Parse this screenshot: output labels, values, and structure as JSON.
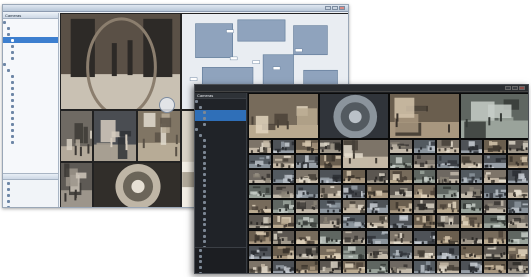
{
  "light_window": {
    "title": "",
    "sidebar_header": "Cameras",
    "tree": [
      {
        "label": "",
        "indent": 0,
        "selected": false
      },
      {
        "label": "",
        "indent": 1,
        "selected": false
      },
      {
        "label": "",
        "indent": 1,
        "selected": false
      },
      {
        "label": "",
        "indent": 2,
        "selected": true
      },
      {
        "label": "",
        "indent": 2,
        "selected": false
      },
      {
        "label": "",
        "indent": 2,
        "selected": false
      },
      {
        "label": "",
        "indent": 2,
        "selected": false
      },
      {
        "label": "",
        "indent": 0,
        "selected": false
      },
      {
        "label": "",
        "indent": 1,
        "selected": false
      },
      {
        "label": "",
        "indent": 2,
        "selected": false
      },
      {
        "label": "",
        "indent": 2,
        "selected": false
      },
      {
        "label": "",
        "indent": 2,
        "selected": false
      },
      {
        "label": "",
        "indent": 2,
        "selected": false
      },
      {
        "label": "",
        "indent": 2,
        "selected": false
      },
      {
        "label": "",
        "indent": 2,
        "selected": false
      },
      {
        "label": "",
        "indent": 2,
        "selected": false
      },
      {
        "label": "",
        "indent": 2,
        "selected": false
      },
      {
        "label": "",
        "indent": 2,
        "selected": false
      },
      {
        "label": "",
        "indent": 2,
        "selected": false
      },
      {
        "label": "",
        "indent": 2,
        "selected": false
      },
      {
        "label": "",
        "indent": 2,
        "selected": false
      }
    ],
    "sidebar_footer_header": "",
    "footer_items": [
      "",
      "",
      "",
      "",
      ""
    ]
  },
  "dark_window": {
    "title": "",
    "sidebar_header": "Cameras",
    "tree": [
      {
        "label": "",
        "indent": 0,
        "selected": false
      },
      {
        "label": "",
        "indent": 1,
        "selected": false
      },
      {
        "label": "",
        "indent": 2,
        "selected": true
      },
      {
        "label": "",
        "indent": 2,
        "selected": true
      },
      {
        "label": "",
        "indent": 2,
        "selected": false
      },
      {
        "label": "",
        "indent": 0,
        "selected": false
      },
      {
        "label": "",
        "indent": 1,
        "selected": false
      },
      {
        "label": "",
        "indent": 2,
        "selected": false
      },
      {
        "label": "",
        "indent": 2,
        "selected": false
      },
      {
        "label": "",
        "indent": 2,
        "selected": false
      },
      {
        "label": "",
        "indent": 2,
        "selected": false
      },
      {
        "label": "",
        "indent": 2,
        "selected": false
      },
      {
        "label": "",
        "indent": 2,
        "selected": false
      },
      {
        "label": "",
        "indent": 2,
        "selected": false
      },
      {
        "label": "",
        "indent": 2,
        "selected": false
      },
      {
        "label": "",
        "indent": 2,
        "selected": false
      },
      {
        "label": "",
        "indent": 2,
        "selected": false
      },
      {
        "label": "",
        "indent": 2,
        "selected": false
      },
      {
        "label": "",
        "indent": 2,
        "selected": false
      },
      {
        "label": "",
        "indent": 2,
        "selected": false
      },
      {
        "label": "",
        "indent": 2,
        "selected": false
      },
      {
        "label": "",
        "indent": 2,
        "selected": false
      },
      {
        "label": "",
        "indent": 2,
        "selected": false
      },
      {
        "label": "",
        "indent": 2,
        "selected": false
      },
      {
        "label": "",
        "indent": 2,
        "selected": false
      },
      {
        "label": "",
        "indent": 2,
        "selected": false
      },
      {
        "label": "",
        "indent": 2,
        "selected": false
      }
    ],
    "footer_items": [
      "",
      "",
      "",
      "",
      "",
      ""
    ]
  },
  "light_feeds": [
    {
      "kind": "revolving-door",
      "palette": [
        "#5a5046",
        "#8b7e6e",
        "#c9c1b3",
        "#2d2a27"
      ]
    },
    {
      "kind": "floor-map",
      "palette": [
        "#e9edf2",
        "#8fa3bd",
        "#5d7896",
        "#ffffff"
      ]
    },
    {
      "kind": "lobby",
      "palette": [
        "#6f6a63",
        "#b4aa9b",
        "#3d3935",
        "#d8d0c2"
      ]
    },
    {
      "kind": "office",
      "palette": [
        "#4a4d52",
        "#a79f92",
        "#d6cdbf",
        "#2f3236"
      ]
    },
    {
      "kind": "atrium",
      "palette": [
        "#807564",
        "#b7ab96",
        "#5a5247",
        "#e2dccf"
      ]
    },
    {
      "kind": "corridor",
      "palette": [
        "#5e5a55",
        "#9c958b",
        "#3a3734",
        "#cfc7bb"
      ]
    },
    {
      "kind": "fisheye-room",
      "palette": [
        "#6b6559",
        "#bfb6a6",
        "#312e2a",
        "#e6e0d4"
      ]
    },
    {
      "kind": "shop",
      "palette": [
        "#3f4245",
        "#8c8477",
        "#c5bcae",
        "#222427"
      ]
    },
    {
      "kind": "bright-hall",
      "palette": [
        "#d9d3c6",
        "#f3efe6",
        "#a59c8c",
        "#7a7163"
      ]
    }
  ],
  "dark_feeds_palettes": [
    [
      "#5b5650",
      "#a29a8c",
      "#2e2b28",
      "#d9d2c4"
    ],
    [
      "#6e6861",
      "#c2b9aa",
      "#3a3632",
      "#8a8275"
    ],
    [
      "#4e5257",
      "#979ea6",
      "#2a2d31",
      "#c9ced4"
    ],
    [
      "#776b5b",
      "#b9a98f",
      "#4b4238",
      "#e0d4bd"
    ],
    [
      "#535a60",
      "#8b949c",
      "#30343a",
      "#bac1c8"
    ],
    [
      "#6a5e4e",
      "#a8977f",
      "#3b342c",
      "#d3c4ab"
    ],
    [
      "#5f6661",
      "#9aa39b",
      "#363b37",
      "#c7cec8"
    ],
    [
      "#7d7468",
      "#c4b8a6",
      "#453f37",
      "#e4dccd"
    ]
  ],
  "colors": {
    "light_chrome": "#dfe7f1",
    "light_selected": "#3d7fcf",
    "dark_chrome": "#2a2d31",
    "dark_selected": "#2f6fb8",
    "map_accent": "#6a87a8"
  }
}
